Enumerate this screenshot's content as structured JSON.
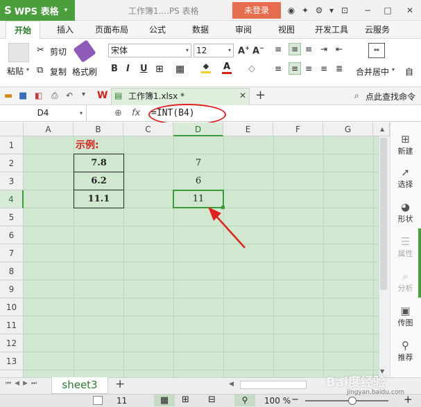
{
  "titlebar": {
    "app_name": "WPS 表格",
    "logo": "S",
    "caret": "▾",
    "doc_title": "工作簿1....PS 表格",
    "login_label": "未登录"
  },
  "ribbon_tabs": [
    "开始",
    "插入",
    "页面布局",
    "公式",
    "数据",
    "审阅",
    "视图",
    "开发工具",
    "云服务"
  ],
  "toolbar": {
    "paste": "粘贴",
    "cut": "剪切",
    "copy": "复制",
    "format_painter": "格式刷",
    "font_name": "宋体",
    "font_size": "12",
    "bold": "B",
    "italic": "I",
    "underline": "U",
    "merge_center": "合并居中",
    "auto_wrap": "自"
  },
  "quick_access": {
    "file_tab": "工作簿1.xlsx *",
    "find_command": "点此查找命令"
  },
  "formula_bar": {
    "name_box": "D4",
    "fx": "fx",
    "formula": "=INT(B4)"
  },
  "grid": {
    "columns": [
      "A",
      "B",
      "C",
      "D",
      "E",
      "F",
      "G"
    ],
    "rows": [
      "1",
      "2",
      "3",
      "4",
      "5",
      "6",
      "7",
      "8",
      "9",
      "10",
      "11",
      "12",
      "13"
    ],
    "example_label": "示例:",
    "b_values": [
      "7.8",
      "6.2",
      "11.1"
    ],
    "d_values": [
      "7",
      "6",
      "11"
    ],
    "example_label_color": "#d9201c",
    "annotation_color": "#e0201f"
  },
  "right_panel": [
    "新建",
    "选择",
    "形状",
    "属性",
    "分析",
    "传图",
    "推荐"
  ],
  "sheet_bar": {
    "sheet_name": "sheet3",
    "add": "+"
  },
  "status_bar": {
    "value": "11",
    "zoom": "100 %"
  },
  "watermark": {
    "brand": "Bai度经验",
    "url": "jingyan.baidu.com"
  },
  "colors": {
    "app_green": "#4a9e3c",
    "login_orange": "#e66e4e",
    "sheet_bg": "#cfe8cf"
  }
}
